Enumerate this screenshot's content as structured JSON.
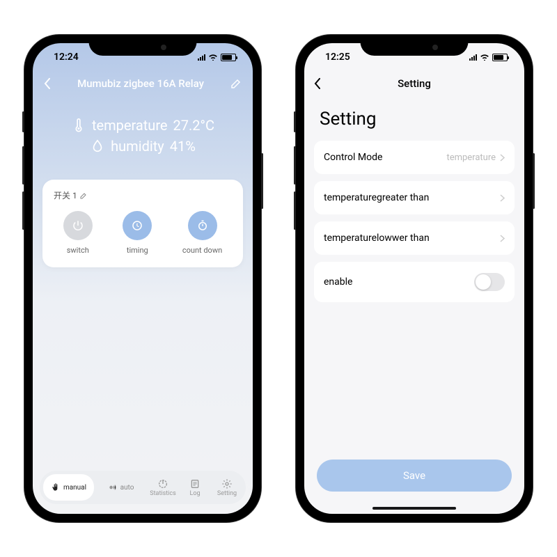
{
  "phone1": {
    "time": "12:24",
    "header_title": "Mumubiz zigbee 16A Relay",
    "hero": {
      "temp_label": "temperature",
      "temp_value": "27.2°C",
      "hum_label": "humidity",
      "hum_value": "41%"
    },
    "card_title": "开关 1",
    "buttons": {
      "switch": "switch",
      "timing": "timing",
      "countdown": "count down"
    },
    "tabbar": {
      "manual": "manual",
      "auto": "auto",
      "statistics": "Statistics",
      "log": "Log",
      "setting": "Setting"
    }
  },
  "phone2": {
    "time": "12:25",
    "header_title": "Setting",
    "section_title": "Setting",
    "rows": {
      "control_mode": {
        "label": "Control Mode",
        "value": "temperature"
      },
      "greater": {
        "label": "temperaturegreater than"
      },
      "lower": {
        "label": "temperaturelowwer than"
      },
      "enable": {
        "label": "enable"
      }
    },
    "save": "Save"
  }
}
